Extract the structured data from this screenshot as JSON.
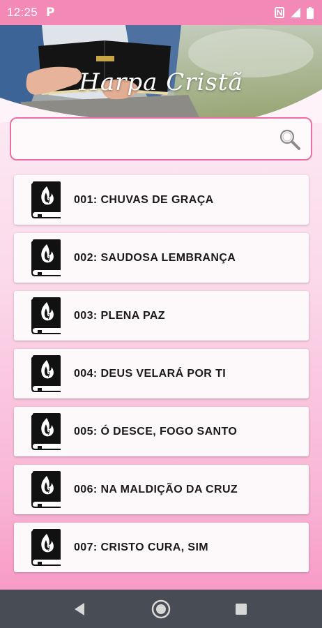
{
  "status_bar": {
    "time": "12:25",
    "notification_icon": "p-letter-icon",
    "icons": [
      "nfc-icon",
      "signal-icon",
      "battery-icon"
    ],
    "background": "#f38ab5"
  },
  "header": {
    "title": "Harpa Cristã"
  },
  "search": {
    "value": "",
    "placeholder": "",
    "icon": "search-icon",
    "border_color": "#ec6ea5"
  },
  "hymns": [
    {
      "label": "001: CHUVAS DE GRAÇA",
      "icon": "bible-flame-icon"
    },
    {
      "label": "002: SAUDOSA LEMBRANÇA",
      "icon": "bible-flame-icon"
    },
    {
      "label": "003: PLENA PAZ",
      "icon": "bible-flame-icon"
    },
    {
      "label": "004: DEUS VELARÁ POR TI",
      "icon": "bible-flame-icon"
    },
    {
      "label": "005: Ó DESCE, FOGO SANTO",
      "icon": "bible-flame-icon"
    },
    {
      "label": "006: NA MALDIÇÃO DA CRUZ",
      "icon": "bible-flame-icon"
    },
    {
      "label": "007: CRISTO CURA, SIM",
      "icon": "bible-flame-icon"
    }
  ],
  "nav_bar": {
    "buttons": [
      "back-icon",
      "home-icon",
      "recents-icon"
    ],
    "background": "#484c54"
  }
}
